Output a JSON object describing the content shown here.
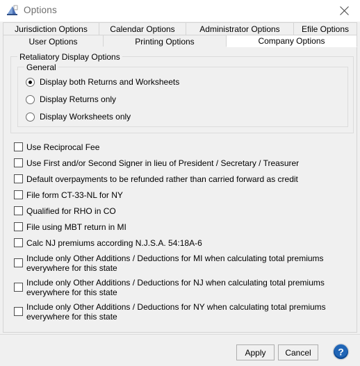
{
  "window": {
    "title": "Options",
    "icon": "options-app-icon",
    "close_icon": "close-icon"
  },
  "tabs": {
    "row1": [
      {
        "label": "Jurisdiction Options",
        "name": "tab-jurisdiction-options",
        "selected": false
      },
      {
        "label": "Calendar Options",
        "name": "tab-calendar-options",
        "selected": false
      },
      {
        "label": "Administrator Options",
        "name": "tab-administrator-options",
        "selected": false
      },
      {
        "label": "Efile Options",
        "name": "tab-efile-options",
        "selected": false
      }
    ],
    "row2": [
      {
        "label": "User Options",
        "name": "tab-user-options",
        "selected": false
      },
      {
        "label": "Printing Options",
        "name": "tab-printing-options",
        "selected": false
      },
      {
        "label": "Company Options",
        "name": "tab-company-options",
        "selected": true
      }
    ]
  },
  "groups": {
    "retaliatory": {
      "title": "Retaliatory Display Options",
      "general": {
        "title": "General",
        "radios": [
          {
            "label": "Display both Returns and Worksheets",
            "checked": true
          },
          {
            "label": "Display Returns only",
            "checked": false
          },
          {
            "label": "Display Worksheets only",
            "checked": false
          }
        ]
      }
    }
  },
  "checkboxes": [
    {
      "label": "Use Reciprocal Fee",
      "checked": false,
      "wrap": false
    },
    {
      "label": "Use First and/or Second Signer in lieu of President / Secretary / Treasurer",
      "checked": false,
      "wrap": false
    },
    {
      "label": "Default overpayments to be refunded rather than carried forward as credit",
      "checked": false,
      "wrap": false
    },
    {
      "label": "File form CT-33-NL for NY",
      "checked": false,
      "wrap": false
    },
    {
      "label": "Qualified for RHO in CO",
      "checked": false,
      "wrap": false
    },
    {
      "label": "File using MBT return in MI",
      "checked": false,
      "wrap": false
    },
    {
      "label": "Calc NJ premiums according N.J.S.A. 54:18A-6",
      "checked": false,
      "wrap": false
    },
    {
      "label": "Include only Other Additions / Deductions for MI when calculating total premiums everywhere for this state",
      "checked": false,
      "wrap": true
    },
    {
      "label": "Include only Other Additions / Deductions for NJ when calculating total premiums everywhere for this state",
      "checked": false,
      "wrap": true
    },
    {
      "label": "Include only Other Additions / Deductions for NY when calculating total premiums everywhere for this state",
      "checked": false,
      "wrap": true
    }
  ],
  "footer": {
    "apply_label": "Apply",
    "cancel_label": "Cancel",
    "help_icon": "help-question-icon"
  },
  "colors": {
    "dialog_background": "#f0f0f0",
    "titlebar_background": "#ffffff",
    "title_text": "#6d6d6d",
    "border": "#d4d4d4",
    "group_border": "#dcdcdc",
    "selected_tab_background": "#ffffff",
    "help_blue": "#1b5fae"
  }
}
